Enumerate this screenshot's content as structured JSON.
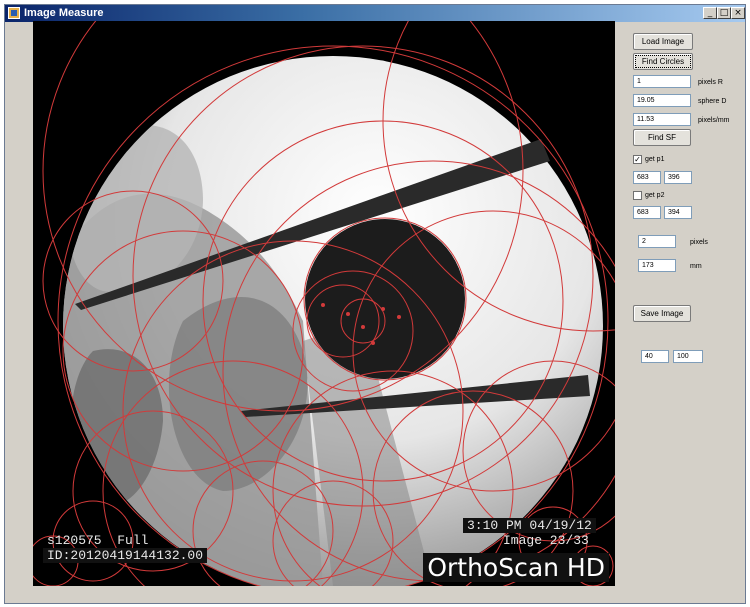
{
  "window": {
    "title": "Image Measure",
    "icon": "app-icon",
    "minimize": "_",
    "maximize": "□",
    "close": "×"
  },
  "controls": {
    "load_image": "Load Image",
    "find_circles": "Find Circles",
    "pixels_r_value": "1",
    "pixels_r_label": "pixels R",
    "sphere_d_value": "19.05",
    "sphere_d_label": "sphere D",
    "pixels_mm_value": "11.53",
    "pixels_mm_label": "pixels/mm",
    "find_sf": "Find SF",
    "get_p1_label": "get p1",
    "get_p1_checked": true,
    "p1_x": "683",
    "p1_y": "396",
    "get_p2_label": "get p2",
    "get_p2_checked": false,
    "p2_x": "683",
    "p2_y": "394",
    "distance_pixels_value": "2",
    "distance_pixels_label": "pixels",
    "distance_mm_value": "173",
    "distance_mm_label": "mm",
    "save_image": "Save Image",
    "range_min": "40",
    "range_max": "100"
  },
  "image": {
    "overlay_top_right_line1": "3:10 PM 04/19/12",
    "overlay_top_right_line2": "Image 23/33",
    "overlay_bottom_left_line1": "s120575  Full",
    "overlay_bottom_left_line2": "ID:20120419144132.00",
    "brand": "OrthoScan HD",
    "circle_color": "#d23a3a"
  }
}
